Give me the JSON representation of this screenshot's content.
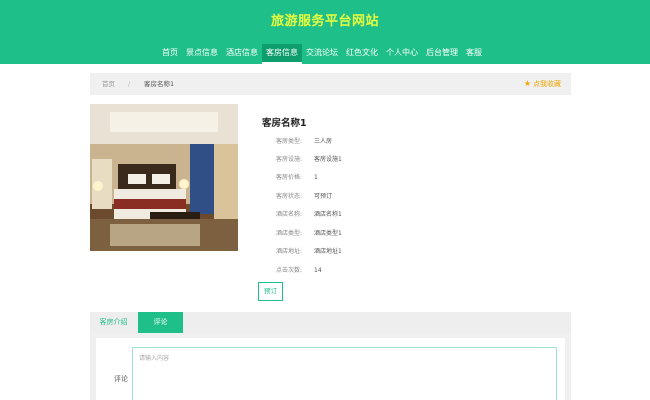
{
  "header": {
    "site_title": "旅游服务平台网站",
    "nav": [
      {
        "label": "首页",
        "active": false
      },
      {
        "label": "景点信息",
        "active": false
      },
      {
        "label": "酒店信息",
        "active": false
      },
      {
        "label": "客房信息",
        "active": true
      },
      {
        "label": "交流论坛",
        "active": false
      },
      {
        "label": "红色文化",
        "active": false
      },
      {
        "label": "个人中心",
        "active": false
      },
      {
        "label": "后台管理",
        "active": false
      },
      {
        "label": "客服",
        "active": false
      }
    ]
  },
  "breadcrumb": {
    "home": "首页",
    "separator": "/",
    "current": "客房名称1",
    "favorite": "点我收藏"
  },
  "room": {
    "title": "客房名称1",
    "fields": [
      {
        "label": "客房类型:",
        "value": "三人房"
      },
      {
        "label": "客房设施:",
        "value": "客房设施1"
      },
      {
        "label": "客房价格:",
        "value": "1"
      },
      {
        "label": "客房状态:",
        "value": "可预订"
      },
      {
        "label": "酒店名称:",
        "value": "酒店名称1"
      },
      {
        "label": "酒店类型:",
        "value": "酒店类型1"
      },
      {
        "label": "酒店地址:",
        "value": "酒店地址1"
      },
      {
        "label": "点击次数:",
        "value": "14"
      }
    ],
    "book_button": "预订"
  },
  "tabs": [
    {
      "label": "客房介绍",
      "active": false
    },
    {
      "label": "评论",
      "active": true
    }
  ],
  "comment": {
    "label": "评论",
    "placeholder": "请输入内容"
  },
  "colors": {
    "brand": "#1fbf8a",
    "title": "#e8ff3d",
    "favorite": "#f0a500"
  }
}
